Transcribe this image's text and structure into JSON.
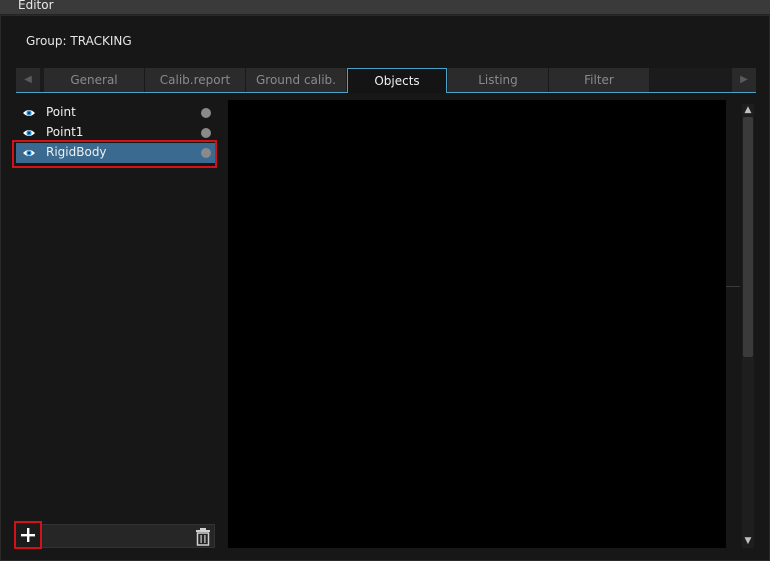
{
  "window": {
    "title": "Editor"
  },
  "group": {
    "label": "Group: TRACKING"
  },
  "tabs": [
    {
      "label": "General"
    },
    {
      "label": "Calib.report"
    },
    {
      "label": "Ground calib."
    },
    {
      "label": "Objects"
    },
    {
      "label": "Listing"
    },
    {
      "label": "Filter"
    }
  ],
  "active_tab": "Objects",
  "objects": [
    {
      "name": "Point",
      "icon": "eye-icon",
      "status_icon": "status-dot-icon"
    },
    {
      "name": "Point1",
      "icon": "eye-icon",
      "status_icon": "status-dot-icon"
    },
    {
      "name": "RigidBody",
      "icon": "eye-icon",
      "status_icon": "status-dot-icon",
      "selected": true
    }
  ],
  "toolbar": {
    "add_icon": "plus-icon",
    "delete_icon": "trash-icon"
  },
  "colors": {
    "accent": "#4aa3c7",
    "selection": "#3a6a8f",
    "highlight": "#d1121a"
  }
}
